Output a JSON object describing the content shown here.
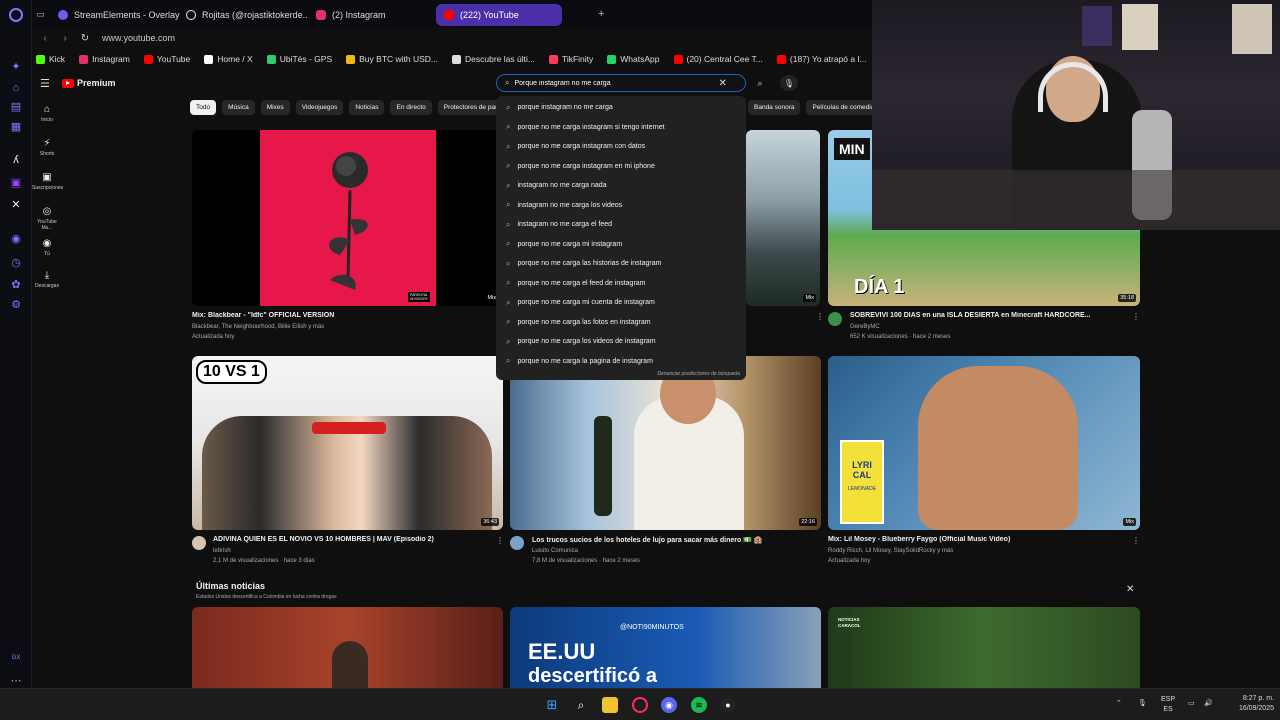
{
  "browser": {
    "tabs": [
      {
        "label": "StreamElements - Overlay",
        "color": "#6c5ce7"
      },
      {
        "label": "Rojitas (@rojastiktokerde...",
        "color": "#111111"
      },
      {
        "label": "(2) Instagram",
        "color": "#e1306c"
      },
      {
        "label": "(222) YouTube",
        "color": "#ff0000"
      }
    ],
    "url": "www.youtube.com",
    "bookmarks": [
      {
        "label": "Kick",
        "color": "#53fc18"
      },
      {
        "label": "Instagram",
        "color": "#e1306c"
      },
      {
        "label": "YouTube",
        "color": "#ff0000"
      },
      {
        "label": "Home / X",
        "color": "#ffffff"
      },
      {
        "label": "UbiTés - GPS",
        "color": "#2ecc71"
      },
      {
        "label": "Buy BTC with USD...",
        "color": "#f0b90b"
      },
      {
        "label": "Descubre las últi...",
        "color": "#dddddd"
      },
      {
        "label": "TikFinity",
        "color": "#ff3b5c"
      },
      {
        "label": "WhatsApp",
        "color": "#25d366"
      },
      {
        "label": "(20) Central Cee T...",
        "color": "#ff0000"
      },
      {
        "label": "(187) Yo atrapó a l...",
        "color": "#ff0000"
      }
    ]
  },
  "youtube": {
    "logo": "Premium",
    "sidebar": [
      {
        "label": "Inicio",
        "icon": "⌂"
      },
      {
        "label": "Shorts",
        "icon": "⚡"
      },
      {
        "label": "Suscripciones",
        "icon": "▣"
      },
      {
        "label": "YouTube Mu...",
        "icon": "◎"
      },
      {
        "label": "Tú",
        "icon": "◉"
      },
      {
        "label": "Descargas",
        "icon": "⤓"
      }
    ],
    "chips": [
      "Todo",
      "Música",
      "Mixes",
      "Videojuegos",
      "Noticias",
      "En directo",
      "Protectores de pantalla"
    ],
    "chips_right": [
      "Banda sonora",
      "Películas de comedia"
    ],
    "search": {
      "value": "Porque instagram no me carga",
      "suggestions": [
        "porque instagram no me carga",
        "porque no me carga instagram si tengo internet",
        "porque no me carga instagram con datos",
        "porque no me carga instagram en mi iphone",
        "instagram no me carga nada",
        "instagram no me carga los videos",
        "instagram no me carga el feed",
        "porque no me carga mi instagram",
        "porque no me carga las historias de instagram",
        "porque no me carga el feed de instagram",
        "porque no me carga mi cuenta de instagram",
        "porque no me carga las fotos en instagram",
        "porque no me carga los videos de instagram",
        "porque no me carga la pagina de instagram"
      ],
      "report": "Denunciar predicciones de búsqueda"
    },
    "videos": [
      {
        "title": "Mix: Blackbear - \"Idfc\" OFFICIAL VERSION",
        "channel": "Blackbear, The Neighbourhood, Billie Eilish y más",
        "meta": "Actualizada hoy",
        "badge": "Mix"
      },
      {
        "title": "",
        "channel": "",
        "meta": "",
        "badge": "Mix"
      },
      {
        "title": "SOBREVIVÍ 100 DÍAS en una ISLA DESIERTA en Minecraft HARDCORE...",
        "channel": "GereByMC",
        "meta": "652 K visualizaciones · hace 2 meses",
        "badge": "35:18"
      },
      {
        "title": "ADIVINA QUIEN ES EL NOVIO VS 10 HOMBRES | MAV (Episodio 2)",
        "channel": "lebrish",
        "meta": "2,1 M de visualizaciones · hace 3 días",
        "badge": "36:43"
      },
      {
        "title": "Los trucos sucios de los hoteles de lujo para sacar más dinero 💵 🏨",
        "channel": "Luisito Comunica",
        "meta": "7,8 M de visualizaciones · hace 2 meses",
        "badge": "22:16"
      },
      {
        "title": "Mix: Lil Mosey - Blueberry Faygo (Official Music Video)",
        "channel": "Roddy Ricch, Lil Mosey, StaySolidRocky y más",
        "meta": "Actualizada hoy",
        "badge": "Mix"
      }
    ],
    "thumb_text": {
      "vs": "10 VS 1",
      "dia": "DÍA 1",
      "mine": "MIN",
      "lyrical": "LYRI CAL",
      "lemonade": "LEMONADE",
      "explicit": "PARENTAL ADVISORY",
      "noti": "@NOTI90MINUTOS",
      "eeuu1": "EE.UU",
      "eeuu2": "descertificó a",
      "caracol": "NOTICIAS CARACOL"
    },
    "news": {
      "title": "Últimas noticias",
      "subtitle": "Estados Unidos descertifica a Colombia en lucha contra drogas"
    }
  },
  "taskbar": {
    "lang1": "ESP",
    "lang2": "ES",
    "time": "8:27 p. m.",
    "date": "16/09/2025",
    "gx": "GX"
  }
}
